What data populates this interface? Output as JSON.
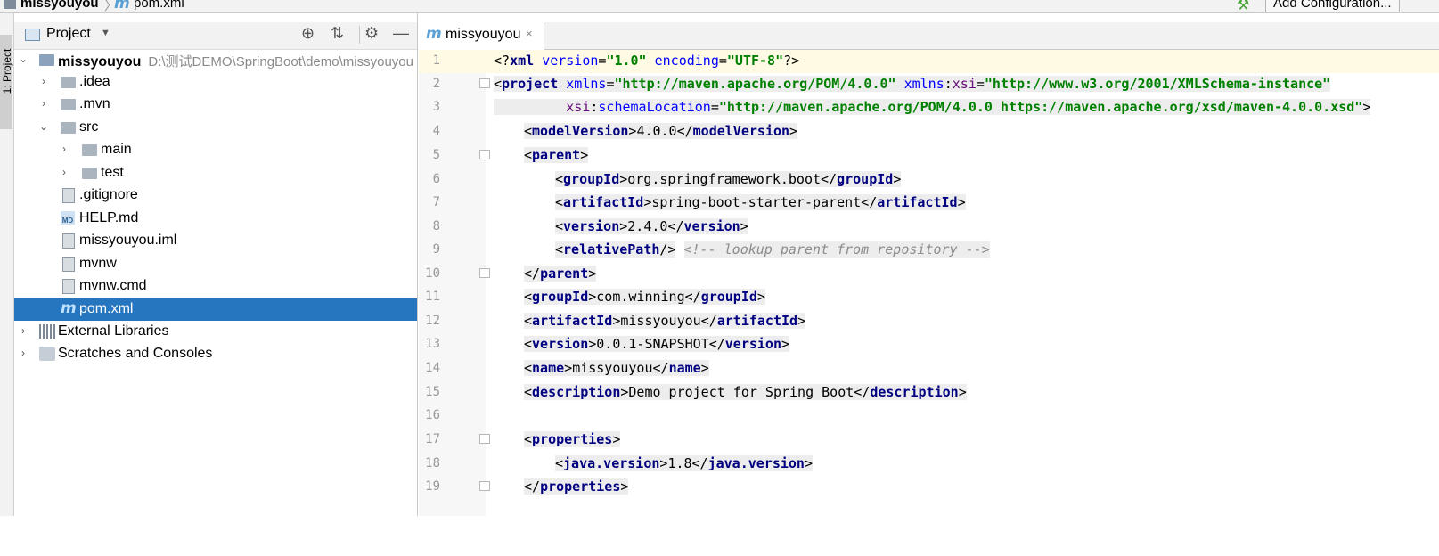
{
  "navbar": {
    "project": "missyouyou",
    "separator": "〉",
    "file_icon": "m",
    "file": "pom.xml",
    "add_configuration": "Add Configuration..."
  },
  "strip": {
    "label": "1: Project"
  },
  "panel": {
    "title": "Project",
    "tree": [
      {
        "label": "missyouyou",
        "path": "D:\\测试DEMO\\SpringBoot\\demo\\missyouyou",
        "chevron": "⌄",
        "bold": true
      },
      {
        "label": ".idea",
        "chevron": "›"
      },
      {
        "label": ".mvn",
        "chevron": "›"
      },
      {
        "label": "src",
        "chevron": "⌄"
      },
      {
        "label": "main",
        "chevron": "›"
      },
      {
        "label": "test",
        "chevron": "›"
      },
      {
        "label": ".gitignore"
      },
      {
        "label": "HELP.md",
        "badge": "MD"
      },
      {
        "label": "missyouyou.iml"
      },
      {
        "label": "mvnw"
      },
      {
        "label": "mvnw.cmd"
      },
      {
        "label": "pom.xml",
        "selected": true
      },
      {
        "label": "External Libraries",
        "chevron": "›"
      },
      {
        "label": "Scratches and Consoles",
        "chevron": "›"
      }
    ]
  },
  "editor": {
    "tab": {
      "icon": "m",
      "label": "missyouyou",
      "close": "×"
    },
    "lines": [
      {
        "n": "1"
      },
      {
        "n": "2"
      },
      {
        "n": "3"
      },
      {
        "n": "4"
      },
      {
        "n": "5"
      },
      {
        "n": "6"
      },
      {
        "n": "7"
      },
      {
        "n": "8"
      },
      {
        "n": "9"
      },
      {
        "n": "10"
      },
      {
        "n": "11"
      },
      {
        "n": "12"
      },
      {
        "n": "13"
      },
      {
        "n": "14"
      },
      {
        "n": "15"
      },
      {
        "n": "16"
      },
      {
        "n": "17"
      },
      {
        "n": "18"
      },
      {
        "n": "19"
      }
    ],
    "code": {
      "xml_decl_version": "\"1.0\"",
      "xml_decl_encoding": "\"UTF-8\"",
      "project_xmlns": "\"http://maven.apache.org/POM/4.0.0\"",
      "project_xsi": "\"http://www.w3.org/2001/XMLSchema-instance\"",
      "schema_location": "\"http://maven.apache.org/POM/4.0.0 https://maven.apache.org/xsd/maven-4.0.0.xsd\"",
      "model_version": "4.0.0",
      "parent_group_id": "org.springframework.boot",
      "parent_artifact_id": "spring-boot-starter-parent",
      "parent_version": "2.4.0",
      "relative_path_comment": "<!-- lookup parent from repository -->",
      "group_id": "com.winning",
      "artifact_id": "missyouyou",
      "version": "0.0.1-SNAPSHOT",
      "name": "missyouyou",
      "description": "Demo project for Spring Boot",
      "java_version": "1.8"
    }
  }
}
